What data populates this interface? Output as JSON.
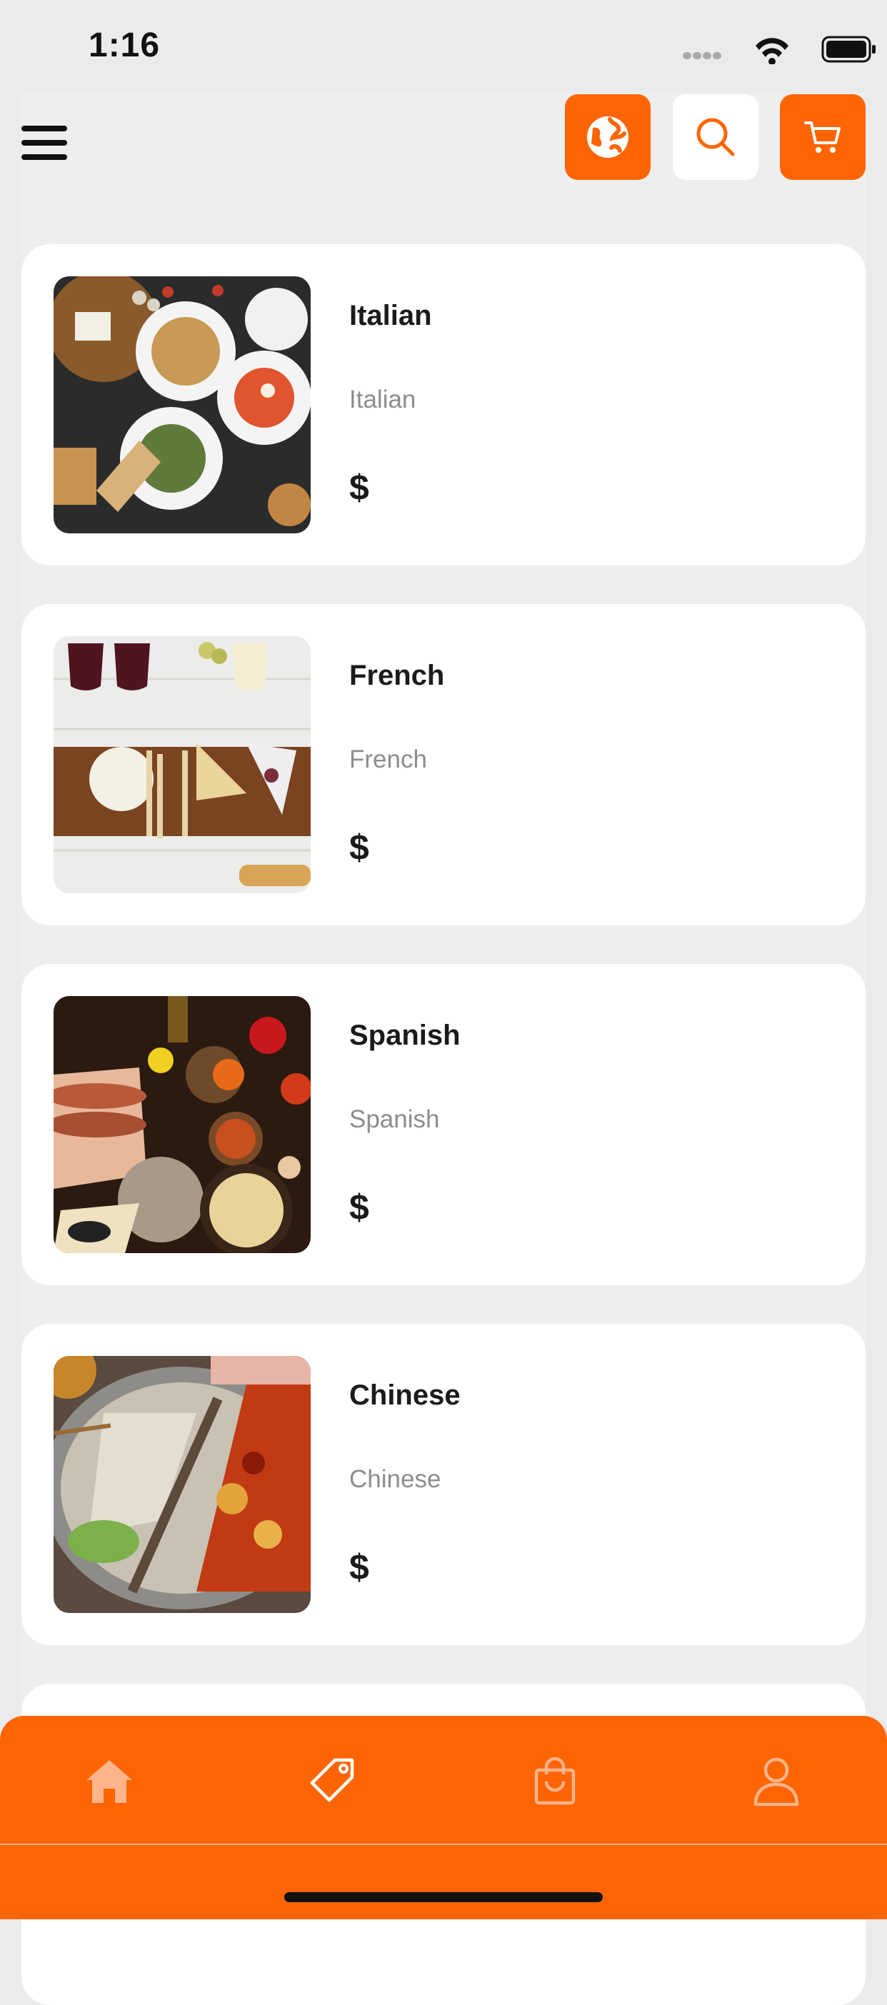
{
  "status_bar": {
    "time": "1:16"
  },
  "header": {
    "menu_icon": "hamburger-menu-icon",
    "buttons": [
      {
        "name": "language-button",
        "icon": "globe-icon",
        "color": "#fd6504"
      },
      {
        "name": "search-button",
        "icon": "search-icon",
        "color": "#ffffff"
      },
      {
        "name": "cart-button",
        "icon": "cart-icon",
        "color": "#fd6504"
      }
    ]
  },
  "categories": [
    {
      "title": "Italian",
      "subtitle": "Italian",
      "price": "$"
    },
    {
      "title": "French",
      "subtitle": "French",
      "price": "$"
    },
    {
      "title": "Spanish",
      "subtitle": "Spanish",
      "price": "$"
    },
    {
      "title": "Chinese",
      "subtitle": "Chinese",
      "price": "$"
    }
  ],
  "tab_bar": {
    "tabs": [
      {
        "name": "home",
        "icon": "home-icon",
        "active": true
      },
      {
        "name": "deals",
        "icon": "tag-icon",
        "active": false
      },
      {
        "name": "orders",
        "icon": "shopping-bag-icon",
        "active": false
      },
      {
        "name": "profile",
        "icon": "user-icon",
        "active": false
      }
    ]
  },
  "colors": {
    "accent": "#fd6504",
    "background": "#ebebeb",
    "card": "#ffffff"
  }
}
